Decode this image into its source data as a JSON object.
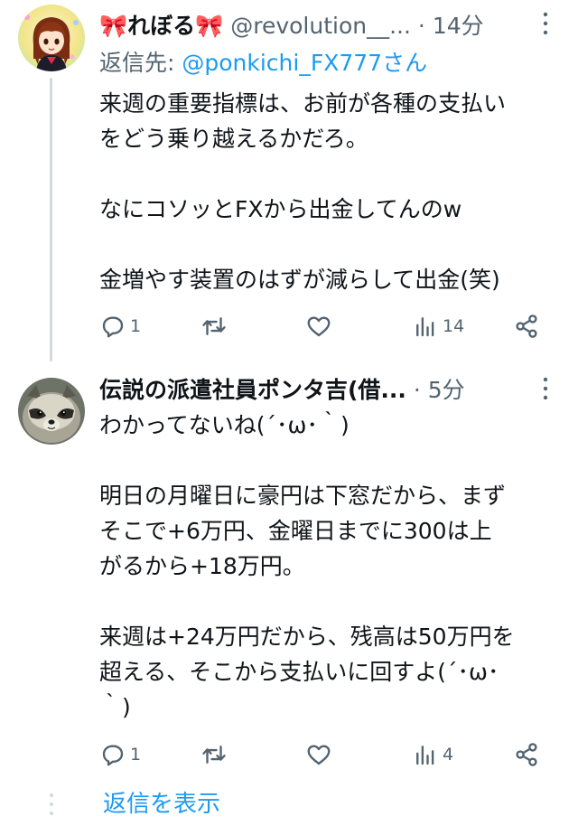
{
  "tweets": [
    {
      "display_name": "🎀れぼる🎀",
      "handle": "@revolution__...",
      "separator": "·",
      "time": "14分",
      "reply_label": "返信先: ",
      "reply_mention": "@ponkichi_FX777さん",
      "text": "来週の重要指標は、お前が各種の支払い\nをどう乗り越えるかだろ。\n\nなにコソッとFXから出金してんのw\n\n金増やす装置のはずが減らして出金(笑)",
      "replies": "1",
      "retweets": "",
      "likes": "",
      "views": "14",
      "avatar_icon": "anime-girl-avatar"
    },
    {
      "display_name": "伝説の派遣社員ポンタ吉(借...",
      "handle": "",
      "separator": "·",
      "time": "5分",
      "text": "わかってないね(´･ω･｀)\n\n明日の月曜日に豪円は下窓だから、まず\nそこで+6万円、金曜日までに300は上\nがるから+18万円。\n\n来週は+24万円だから、残高は50万円を\n超える、そこから支払いに回すよ(´･ω･\n｀)",
      "replies": "1",
      "retweets": "",
      "likes": "",
      "views": "4",
      "avatar_icon": "raccoon-dog-avatar"
    }
  ],
  "show_replies": "返信を表示",
  "colors": {
    "text": "#0f1419",
    "secondary": "#536471",
    "link": "#1d9bf0",
    "thread_line": "#cfd9de"
  }
}
